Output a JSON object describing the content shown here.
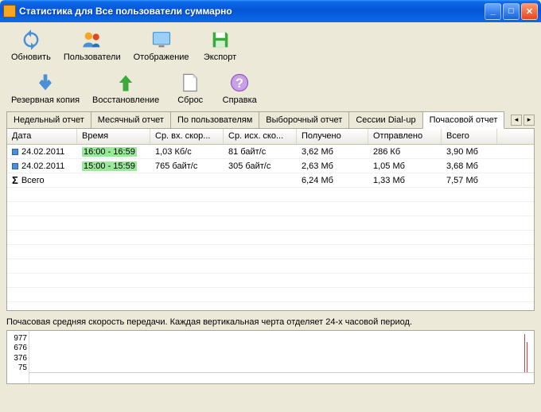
{
  "window": {
    "title": "Статистика для Все пользователи суммарно"
  },
  "toolbar_row1": [
    {
      "id": "refresh",
      "label": "Обновить",
      "icon": "refresh"
    },
    {
      "id": "users",
      "label": "Пользователи",
      "icon": "users"
    },
    {
      "id": "display",
      "label": "Отображение",
      "icon": "display"
    },
    {
      "id": "export",
      "label": "Экспорт",
      "icon": "save"
    }
  ],
  "toolbar_row2": [
    {
      "id": "backup",
      "label": "Резервная копия",
      "icon": "arrow-down"
    },
    {
      "id": "restore",
      "label": "Восстановление",
      "icon": "arrow-up"
    },
    {
      "id": "reset",
      "label": "Сброс",
      "icon": "blank-page"
    },
    {
      "id": "help",
      "label": "Справка",
      "icon": "help"
    }
  ],
  "tabs": [
    {
      "label": "Недельный отчет",
      "active": false
    },
    {
      "label": "Месячный отчет",
      "active": false
    },
    {
      "label": "По пользователям",
      "active": false
    },
    {
      "label": "Выборочный отчет",
      "active": false
    },
    {
      "label": "Сессии Dial-up",
      "active": false
    },
    {
      "label": "Почасовой отчет",
      "active": true
    }
  ],
  "grid": {
    "columns": [
      "Дата",
      "Время",
      "Ср. вх. скор...",
      "Ср. исх. ско...",
      "Получено",
      "Отправлено",
      "Всего"
    ],
    "rows": [
      {
        "icon": true,
        "date": "24.02.2011",
        "time": "16:00 - 16:59",
        "time_hl": true,
        "in": "1,03 Кб/с",
        "out": "81 байт/с",
        "recv": "3,62 Мб",
        "sent": "286 Кб",
        "total": "3,90 Мб"
      },
      {
        "icon": true,
        "date": "24.02.2011",
        "time": "15:00 - 15:59",
        "time_hl": true,
        "in": "765 байт/с",
        "out": "305 байт/с",
        "recv": "2,63 Мб",
        "sent": "1,05 Мб",
        "total": "3,68 Мб"
      }
    ],
    "total_row": {
      "label": "Всего",
      "recv": "6,24 Мб",
      "sent": "1,33 Мб",
      "total": "7,57 Мб"
    }
  },
  "chart": {
    "description": "Почасовая средняя скорость передачи. Каждая вертикальная черта отделяет 24-х часовой период.",
    "y_ticks": [
      "977",
      "676",
      "376",
      "75"
    ]
  },
  "chart_data": {
    "type": "bar",
    "title": "Почасовая средняя скорость передачи",
    "xlabel": "",
    "ylabel": "",
    "ylim": [
      0,
      977
    ],
    "categories": [
      "15:00",
      "16:00"
    ],
    "values": [
      765,
      977
    ]
  }
}
